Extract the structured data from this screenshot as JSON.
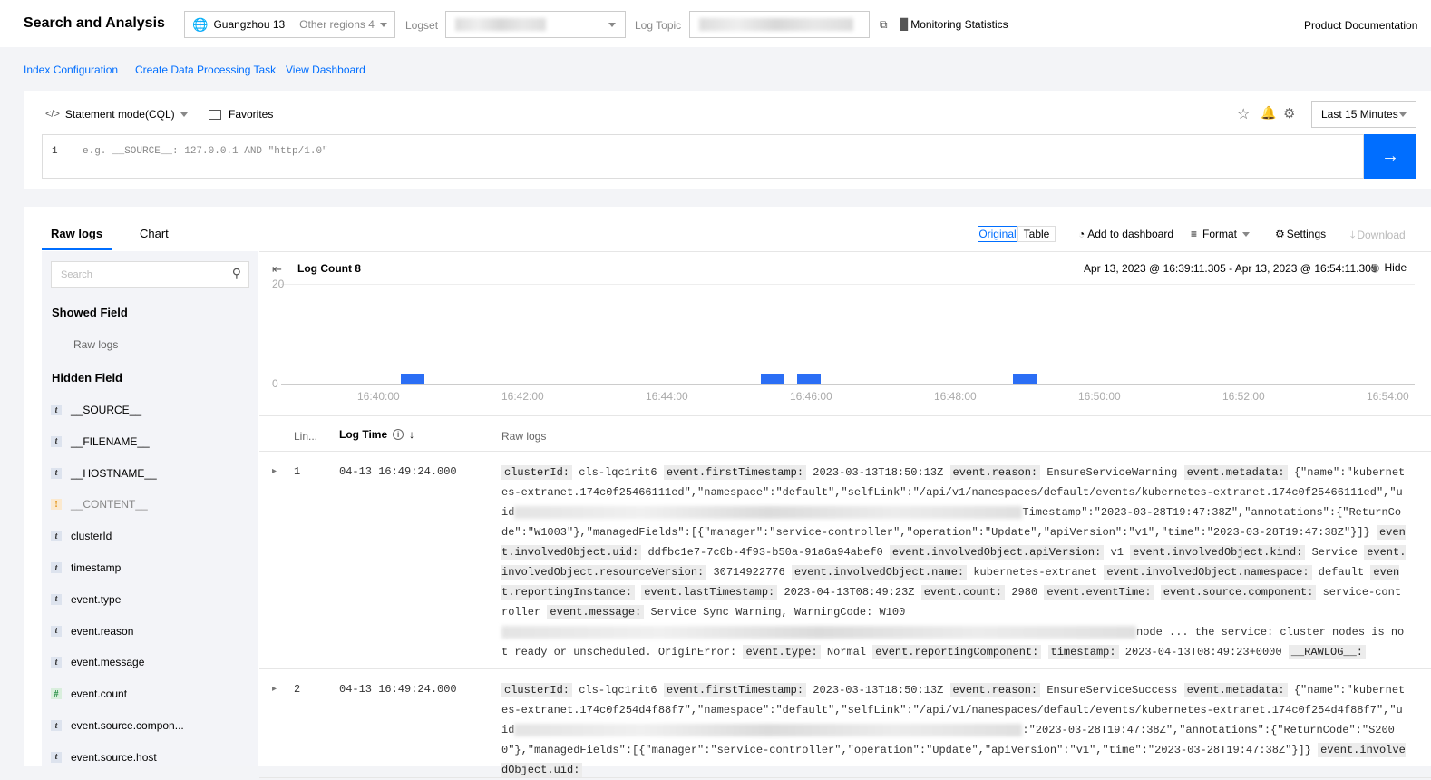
{
  "header": {
    "title": "Search and Analysis",
    "region": "Guangzhou 13",
    "other_regions": "Other regions 4",
    "logset_label": "Logset",
    "topic_label": "Log Topic",
    "monitoring": "Monitoring Statistics",
    "docs": "Product Documentation"
  },
  "links": [
    "Index Configuration",
    "Create Data Processing Task",
    "View Dashboard"
  ],
  "query": {
    "mode": "Statement mode(CQL)",
    "favorites": "Favorites",
    "line_no": "1",
    "placeholder": "e.g. __SOURCE__: 127.0.0.1 AND \"http/1.0\"",
    "time_range": "Last 15 Minutes"
  },
  "tabs": [
    "Raw logs",
    "Chart"
  ],
  "toolbar": {
    "original": "Original",
    "table": "Table",
    "add_dashboard": "Add to dashboard",
    "format": "Format",
    "settings": "Settings",
    "download": "Download"
  },
  "sidebar": {
    "search_placeholder": "Search",
    "showed_title": "Showed Field",
    "showed": [
      "Raw logs"
    ],
    "hidden_title": "Hidden Field",
    "hidden": [
      {
        "type": "t",
        "name": "__SOURCE__"
      },
      {
        "type": "t",
        "name": "__FILENAME__"
      },
      {
        "type": "t",
        "name": "__HOSTNAME__"
      },
      {
        "type": "!",
        "name": "__CONTENT__"
      },
      {
        "type": "t",
        "name": "clusterId"
      },
      {
        "type": "t",
        "name": "timestamp"
      },
      {
        "type": "t",
        "name": "event.type"
      },
      {
        "type": "t",
        "name": "event.reason"
      },
      {
        "type": "t",
        "name": "event.message"
      },
      {
        "type": "#",
        "name": "event.count"
      },
      {
        "type": "t",
        "name": "event.source.compon..."
      },
      {
        "type": "t",
        "name": "event.source.host"
      }
    ]
  },
  "histogram": {
    "title": "Log Count 8",
    "range": "Apr 13, 2023 @ 16:39:11.305 - Apr 13, 2023 @ 16:54:11.305",
    "hide": "Hide",
    "accent": "#2b6ef5"
  },
  "chart_data": {
    "type": "bar",
    "title": "Log Count 8",
    "ylim": [
      0,
      20
    ],
    "yticks": [
      "0",
      "20"
    ],
    "xticks": [
      "16:40:00",
      "16:42:00",
      "16:44:00",
      "16:46:00",
      "16:48:00",
      "16:50:00",
      "16:52:00",
      "16:54:00"
    ],
    "x_seconds_from_1640": [
      20,
      320,
      350,
      530
    ],
    "values": [
      2,
      2,
      2,
      2
    ]
  },
  "table": {
    "col_line": "Lin...",
    "col_time": "Log Time",
    "col_raw": "Raw logs"
  },
  "rows": [
    {
      "line": "1",
      "time": "04-13 16:49:24.000",
      "segments": [
        {
          "k": "clusterId:",
          "v": "cls-lqc1rit6"
        },
        {
          "k": "event.firstTimestamp:",
          "v": "2023-03-13T18:50:13Z"
        },
        {
          "k": "event.reason:",
          "v": "EnsureServiceWarning"
        },
        {
          "k": "event.metadata:",
          "v": "{\"name\":\"kubernetes-extranet.174c0f25466111ed\",\"namespace\":\"default\",\"selfLink\":\"/api/v1/namespaces/default/events/kubernetes-extranet.174c0f25466111ed\",\"uid",
          "redact": true,
          "v2": "Timestamp\":\"2023-03-28T19:47:38Z\",\"annotations\":{\"ReturnCode\":\"W1003\"},\"managedFields\":[{\"manager\":\"service-controller\",\"operation\":\"Update\",\"apiVersion\":\"v1\",\"time\":\"2023-03-28T19:47:38Z\"}]}"
        },
        {
          "k": "event.involvedObject.uid:",
          "v": "ddfbc1e7-7c0b-4f93-b50a-91a6a94abef0"
        },
        {
          "k": "event.involvedObject.apiVersion:",
          "v": "v1"
        },
        {
          "k": "event.involvedObject.kind:",
          "v": "Service"
        },
        {
          "k": "event.involvedObject.resourceVersion:",
          "v": "30714922776"
        },
        {
          "k": "event.involvedObject.name:",
          "v": "kubernetes-extranet"
        },
        {
          "k": "event.involvedObject.namespace:",
          "v": "default"
        },
        {
          "k": "event.reportingInstance:",
          "v": ""
        },
        {
          "k": "event.lastTimestamp:",
          "v": "2023-04-13T08:49:23Z"
        },
        {
          "k": "event.count:",
          "v": "2980"
        },
        {
          "k": "event.eventTime:",
          "v": ""
        },
        {
          "k": "event.source.component:",
          "v": "service-controller"
        },
        {
          "k": "event.message:",
          "v": "Service Sync Warning, WarningCode: W100",
          "redact": true,
          "v2": "node ... the service: cluster nodes is not ready or unscheduled. OriginError:"
        },
        {
          "k": "event.type:",
          "v": "Normal"
        },
        {
          "k": "event.reportingComponent:",
          "v": ""
        },
        {
          "k": "timestamp:",
          "v": "2023-04-13T08:49:23+0000"
        },
        {
          "k": "__RAWLOG__:",
          "v": ""
        }
      ]
    },
    {
      "line": "2",
      "time": "04-13 16:49:24.000",
      "segments": [
        {
          "k": "clusterId:",
          "v": "cls-lqc1rit6"
        },
        {
          "k": "event.firstTimestamp:",
          "v": "2023-03-13T18:50:13Z"
        },
        {
          "k": "event.reason:",
          "v": "EnsureServiceSuccess"
        },
        {
          "k": "event.metadata:",
          "v": "{\"name\":\"kubernetes-extranet.174c0f254d4f88f7\",\"namespace\":\"default\",\"selfLink\":\"/api/v1/namespaces/default/events/kubernetes-extranet.174c0f254d4f88f7\",\"uid",
          "redact": true,
          "v2": ":\"2023-03-28T19:47:38Z\",\"annotations\":{\"ReturnCode\":\"S2000\"},\"managedFields\":[{\"manager\":\"service-controller\",\"operation\":\"Update\",\"apiVersion\":\"v1\",\"time\":\"2023-03-28T19:47:38Z\"}]}"
        },
        {
          "k": "event.involvedObject.uid:",
          "v": ""
        }
      ]
    }
  ]
}
